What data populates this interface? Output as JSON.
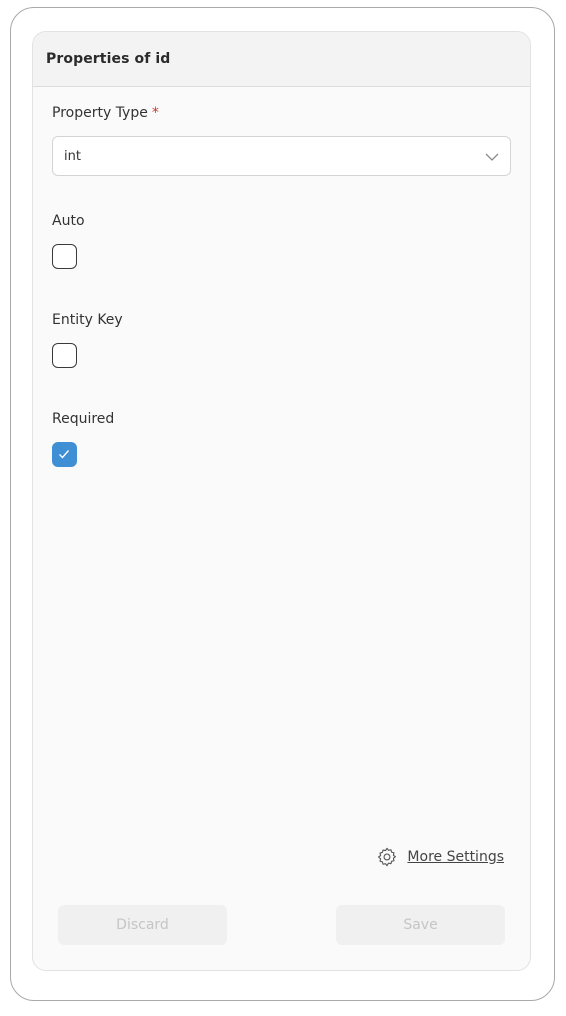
{
  "panel": {
    "title": "Properties of id"
  },
  "fields": {
    "property_type": {
      "label": "Property Type",
      "required_mark": "*",
      "value": "int"
    },
    "auto": {
      "label": "Auto",
      "checked": false
    },
    "entity_key": {
      "label": "Entity Key",
      "checked": false
    },
    "required": {
      "label": "Required",
      "checked": true
    }
  },
  "links": {
    "more_settings": "More Settings"
  },
  "buttons": {
    "discard": "Discard",
    "save": "Save"
  },
  "colors": {
    "accent": "#3e8fd3",
    "required": "#c0392b",
    "disabled_text": "#c5c5c5"
  },
  "icons": {
    "select_chevron": "chevron-down-icon",
    "checkmark": "check-icon",
    "settings": "gear-icon"
  }
}
